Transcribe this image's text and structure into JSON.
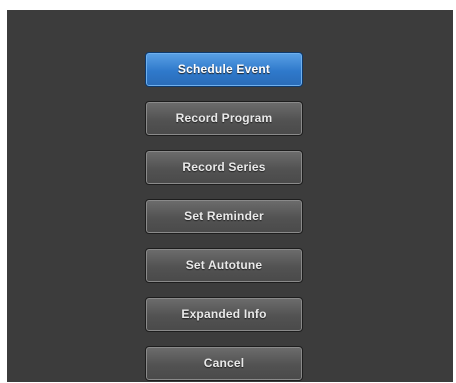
{
  "menu": {
    "items": [
      {
        "label": "Schedule Event",
        "selected": true
      },
      {
        "label": "Record Program",
        "selected": false
      },
      {
        "label": "Record Series",
        "selected": false
      },
      {
        "label": "Set Reminder",
        "selected": false
      },
      {
        "label": "Set Autotune",
        "selected": false
      },
      {
        "label": "Expanded Info",
        "selected": false
      },
      {
        "label": "Cancel",
        "selected": false
      }
    ]
  },
  "colors": {
    "background": "#3c3c3c",
    "button": "#555555",
    "selected_button": "#3a86d6",
    "text": "#e9e9e9"
  }
}
